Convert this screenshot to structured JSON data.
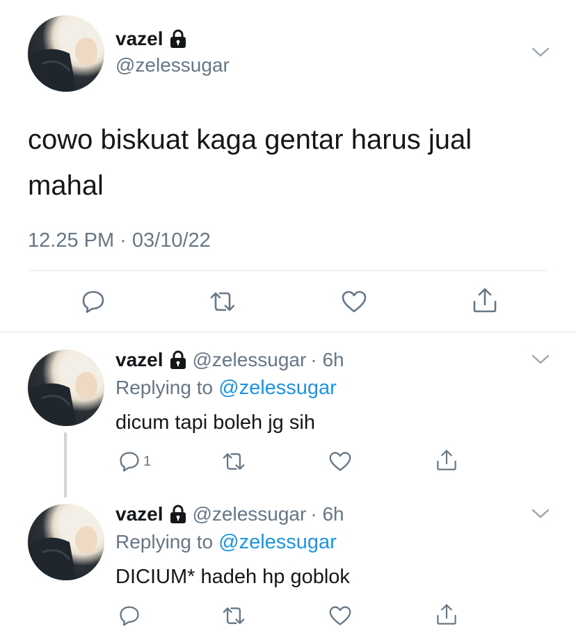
{
  "main_tweet": {
    "name": "vazel",
    "handle": "@zelessugar",
    "text": "cowo biskuat kaga gentar harus jual mahal",
    "timestamp": "12.25 PM · 03/10/22"
  },
  "replies": [
    {
      "name": "vazel",
      "handle": "@zelessugar",
      "time": "· 6h",
      "replying_label": "Replying to",
      "replying_handle": "@zelessugar",
      "text": "dicum tapi boleh jg sih",
      "reply_count": "1"
    },
    {
      "name": "vazel",
      "handle": "@zelessugar",
      "time": "· 6h",
      "replying_label": "Replying to",
      "replying_handle": "@zelessugar",
      "text": "DICIUM* hadeh hp goblok",
      "reply_count": ""
    }
  ],
  "icons": [
    "lock-icon",
    "chevron-down-icon",
    "reply-icon",
    "retweet-icon",
    "like-icon",
    "share-icon"
  ],
  "colors": {
    "text": "#14171a",
    "secondary": "#657786",
    "link": "#1b95e0",
    "divider": "#e1e8ed"
  }
}
